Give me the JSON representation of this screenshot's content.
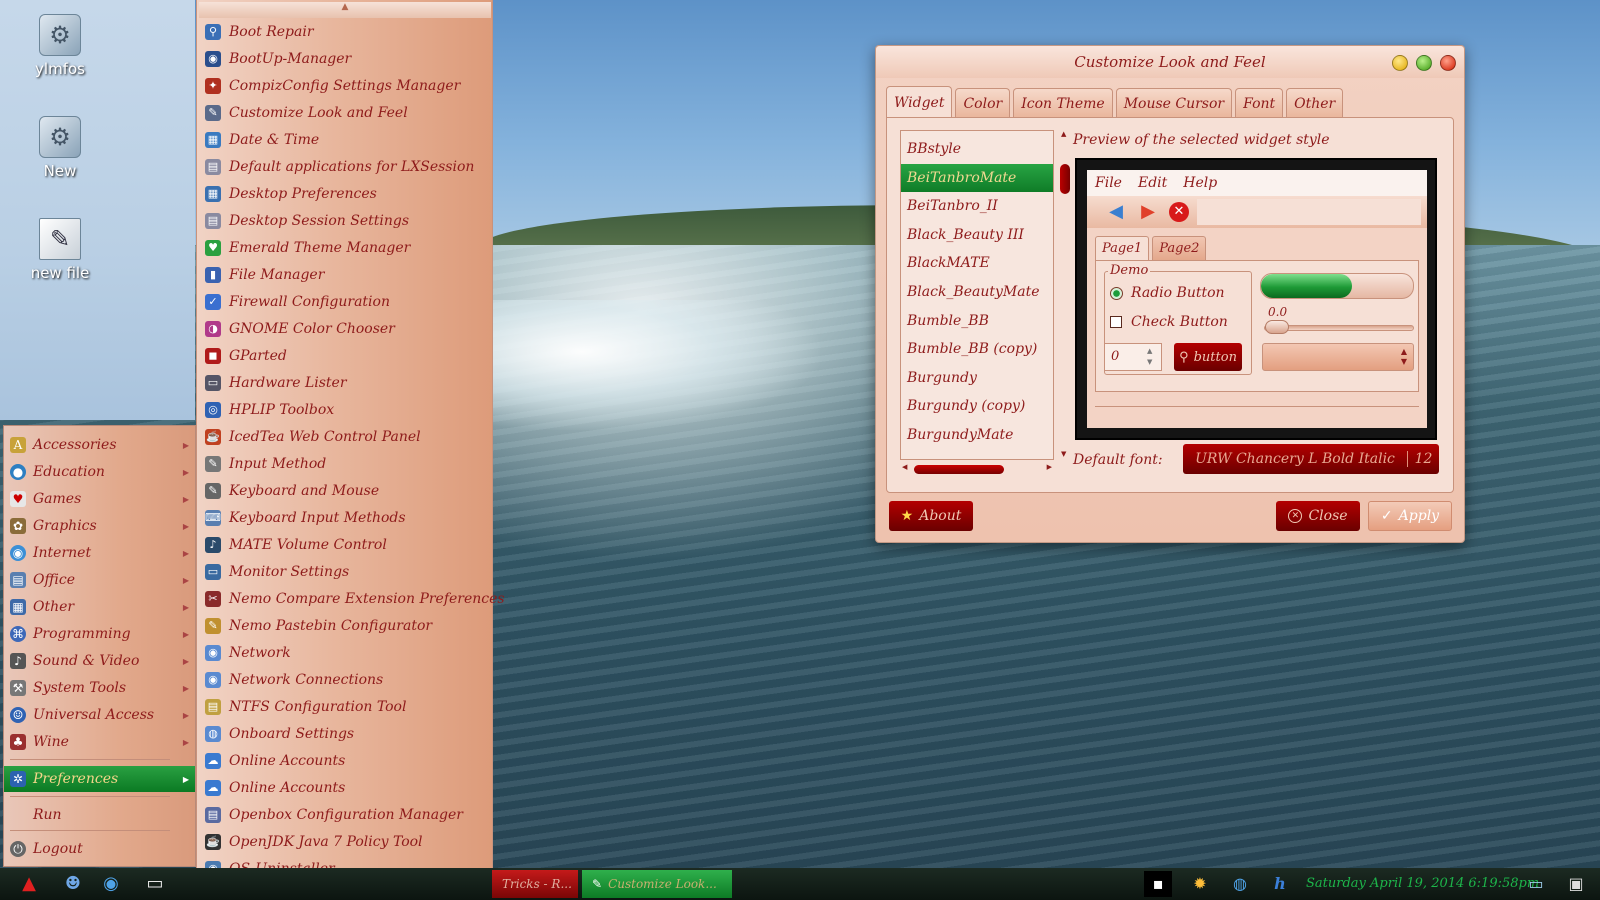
{
  "desktop": {
    "icons": [
      {
        "label": "ylmfos"
      },
      {
        "label": "New"
      },
      {
        "label": "new file"
      }
    ]
  },
  "start_menu": {
    "categories": [
      {
        "label": "Accessories"
      },
      {
        "label": "Education"
      },
      {
        "label": "Games"
      },
      {
        "label": "Graphics"
      },
      {
        "label": "Internet"
      },
      {
        "label": "Office"
      },
      {
        "label": "Other"
      },
      {
        "label": "Programming"
      },
      {
        "label": "Sound & Video"
      },
      {
        "label": "System Tools"
      },
      {
        "label": "Universal Access"
      },
      {
        "label": "Wine"
      }
    ],
    "active_category": "Preferences",
    "run_label": "Run",
    "logout_label": "Logout"
  },
  "preferences_menu": {
    "items": [
      {
        "label": "Boot Repair"
      },
      {
        "label": "BootUp-Manager"
      },
      {
        "label": "CompizConfig Settings Manager"
      },
      {
        "label": "Customize Look and Feel"
      },
      {
        "label": "Date & Time"
      },
      {
        "label": "Default applications for LXSession"
      },
      {
        "label": "Desktop Preferences"
      },
      {
        "label": "Desktop Session Settings"
      },
      {
        "label": "Emerald Theme Manager"
      },
      {
        "label": "File Manager"
      },
      {
        "label": "Firewall Configuration"
      },
      {
        "label": "GNOME Color Chooser"
      },
      {
        "label": "GParted"
      },
      {
        "label": "Hardware Lister"
      },
      {
        "label": "HPLIP Toolbox"
      },
      {
        "label": "IcedTea Web Control Panel"
      },
      {
        "label": "Input Method"
      },
      {
        "label": "Keyboard and Mouse"
      },
      {
        "label": "Keyboard Input Methods"
      },
      {
        "label": "MATE Volume Control"
      },
      {
        "label": "Monitor Settings"
      },
      {
        "label": "Nemo Compare Extension Preferences"
      },
      {
        "label": "Nemo Pastebin Configurator"
      },
      {
        "label": "Network"
      },
      {
        "label": "Network Connections"
      },
      {
        "label": "NTFS Configuration Tool"
      },
      {
        "label": "Onboard Settings"
      },
      {
        "label": "Online Accounts"
      },
      {
        "label": "Online Accounts"
      },
      {
        "label": "Openbox Configuration Manager"
      },
      {
        "label": "OpenJDK Java 7 Policy Tool"
      },
      {
        "label": "OS-Uninstaller"
      }
    ]
  },
  "window": {
    "title": "Customize Look and Feel",
    "tabs": [
      {
        "label": "Widget"
      },
      {
        "label": "Color"
      },
      {
        "label": "Icon Theme"
      },
      {
        "label": "Mouse Cursor"
      },
      {
        "label": "Font"
      },
      {
        "label": "Other"
      }
    ],
    "themes": [
      {
        "label": "BBstyle"
      },
      {
        "label": "BeiTanbroMate"
      },
      {
        "label": "BeiTanbro_II"
      },
      {
        "label": "Black_Beauty III"
      },
      {
        "label": "BlackMATE"
      },
      {
        "label": "Black_BeautyMate"
      },
      {
        "label": "Bumble_BB"
      },
      {
        "label": "Bumble_BB (copy)"
      },
      {
        "label": "Burgundy"
      },
      {
        "label": "Burgundy (copy)"
      },
      {
        "label": "BurgundyMate"
      }
    ],
    "selected_theme_index": 1,
    "preview_label": "Preview of the selected widget style",
    "preview": {
      "menu": [
        "File",
        "Edit",
        "Help"
      ],
      "tabs": [
        "Page1",
        "Page2"
      ],
      "demo_label": "Demo",
      "radio_label": "Radio Button",
      "check_label": "Check Button",
      "spin_value": "0",
      "button_label": "button",
      "progress_fraction": 0.6,
      "scale_value": "0.0",
      "scale_fraction": 0.0
    },
    "default_font_label": "Default font:",
    "default_font_name": "URW Chancery L Bold Italic",
    "default_font_size": "12",
    "about_label": "About",
    "close_label": "Close",
    "apply_label": "Apply"
  },
  "taskbar": {
    "tasks": [
      {
        "label": "Tricks - R..."
      },
      {
        "label": "Customize Look..."
      }
    ],
    "clock": "Saturday April 19, 2014   6:19:58pm"
  },
  "colors": {
    "accent_red": "#8e1b1b",
    "selection_green": "#0f7c27",
    "button_red": "#b30000",
    "clock_green": "#1db54a"
  },
  "icons": {
    "close": "close-icon",
    "about": "star-icon",
    "apply": "checkmark-icon",
    "back": "back-arrow-icon",
    "forward": "forward-arrow-icon",
    "stop": "stop-icon"
  }
}
